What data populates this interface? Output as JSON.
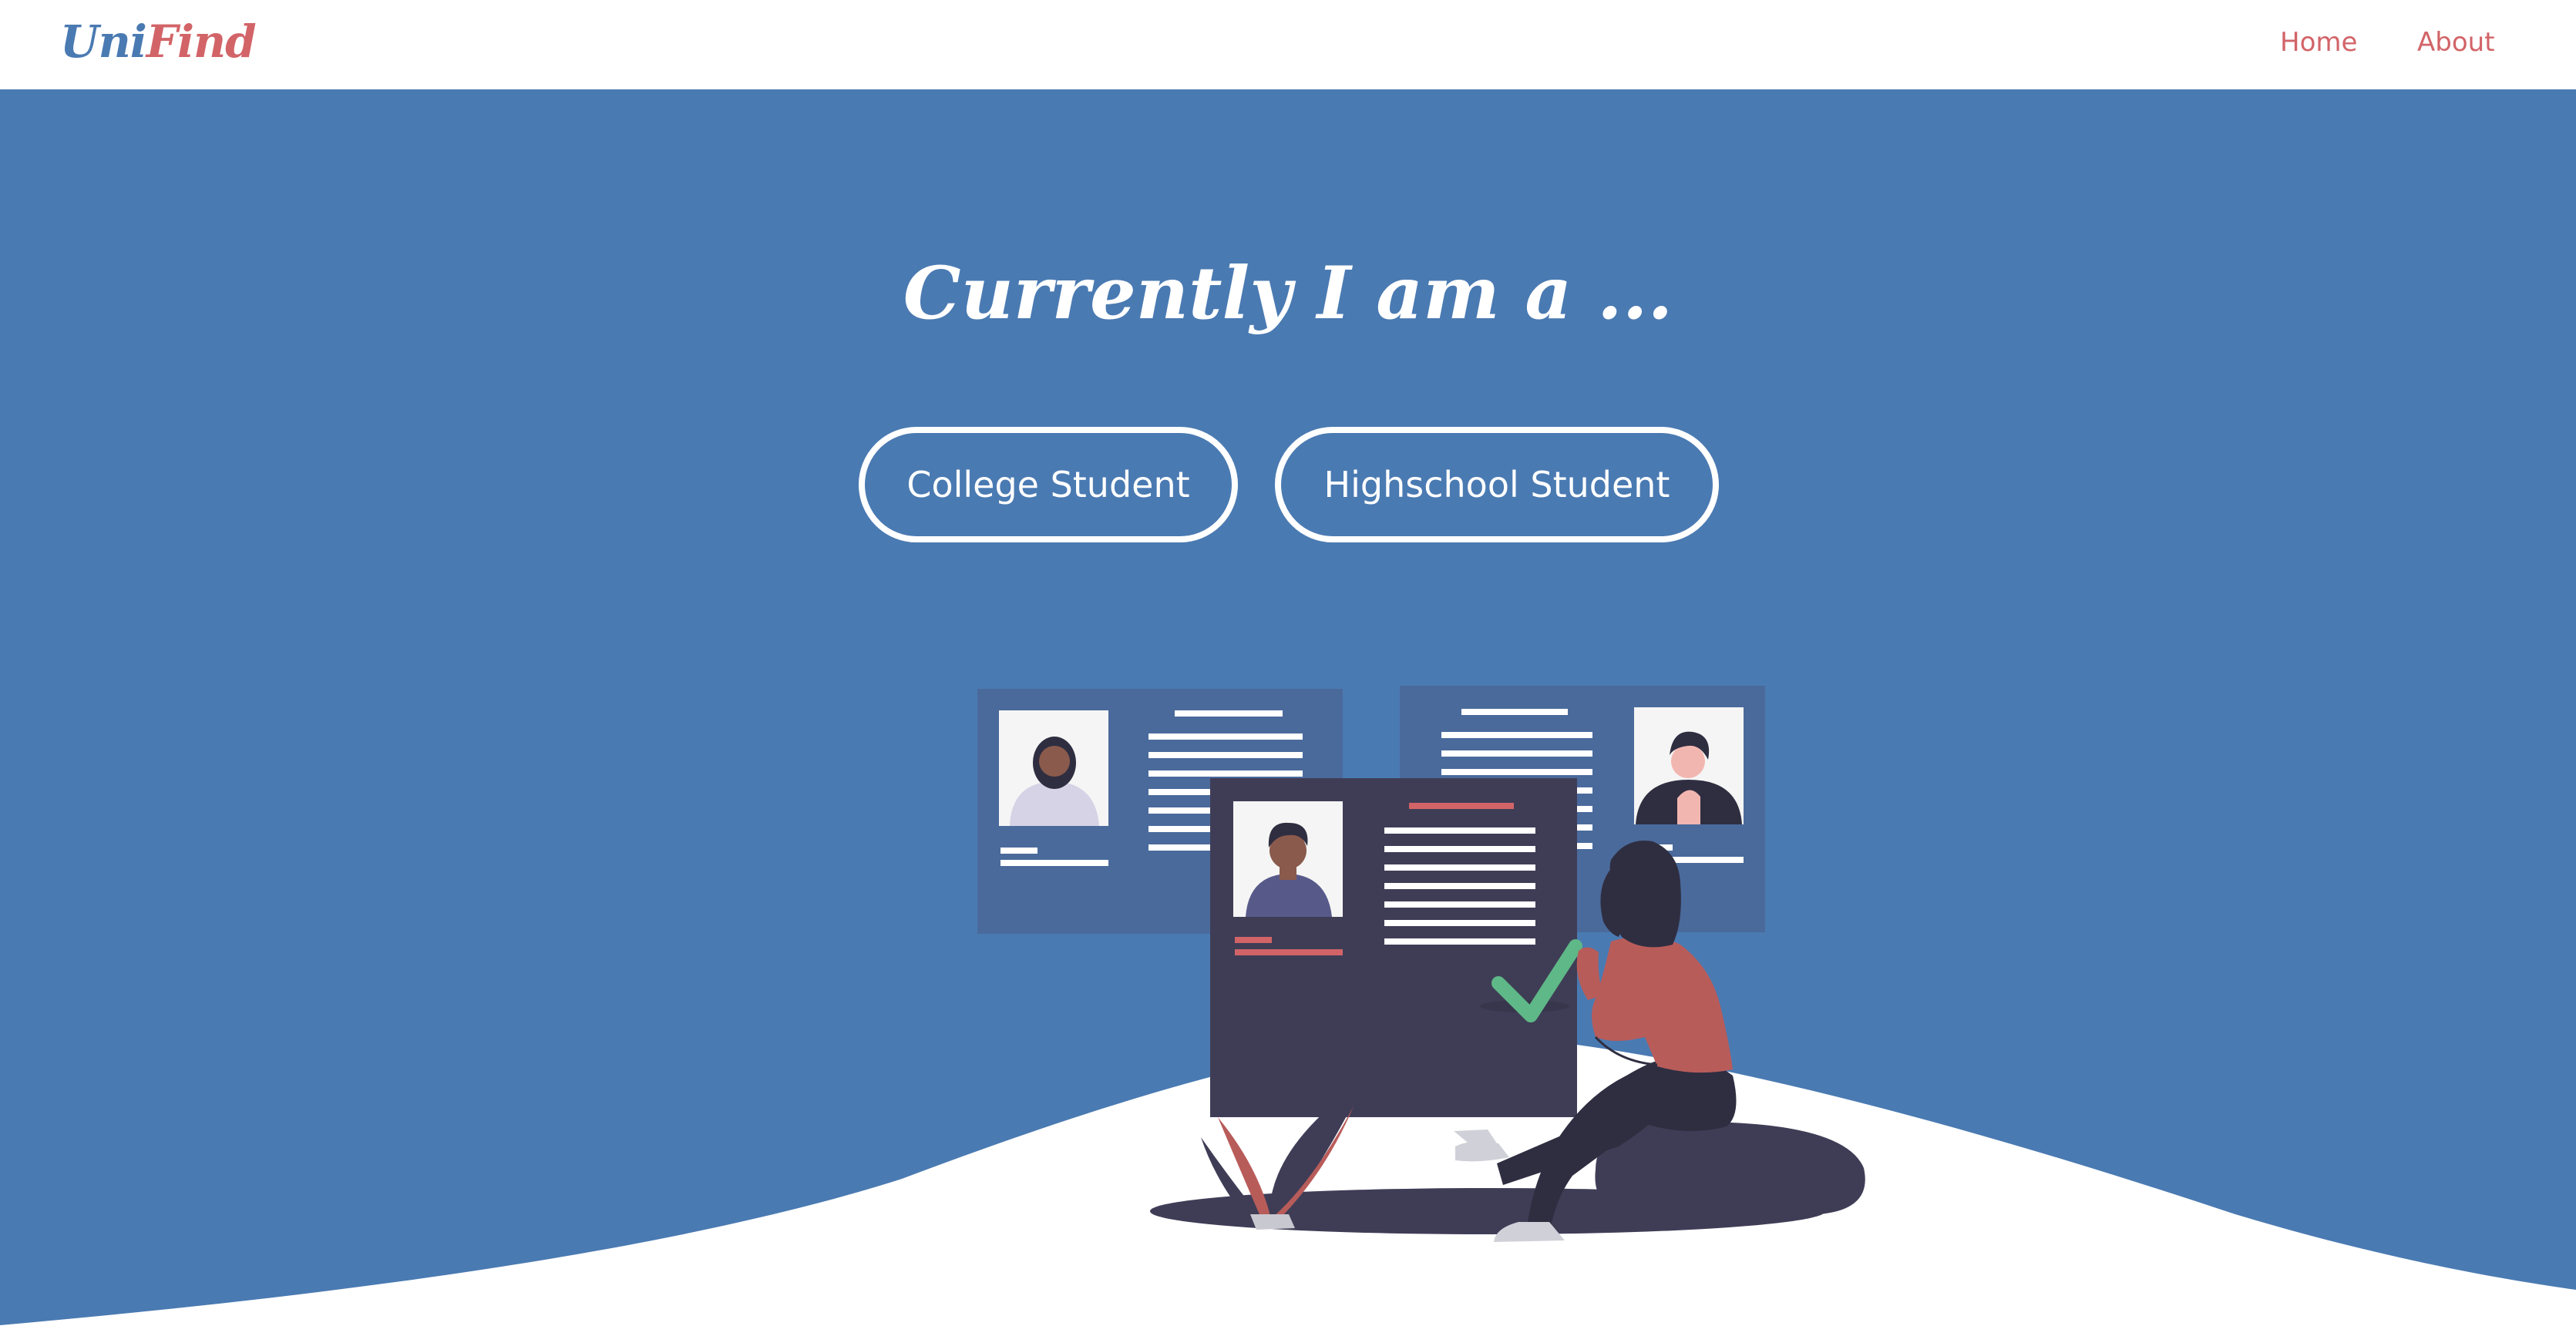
{
  "nav": {
    "logo_part1": "Uni",
    "logo_part2": "Find",
    "links": [
      "Home",
      "About"
    ]
  },
  "hero": {
    "headline": "Currently I am a ...",
    "options": [
      "College Student",
      "Highschool Student"
    ]
  },
  "colors": {
    "brand_blue": "#4a7ab2",
    "accent_red": "#d26468",
    "white": "#ffffff",
    "dark": "#3f3d56",
    "check_green": "#5fb887"
  },
  "icons": [
    "check-icon"
  ]
}
